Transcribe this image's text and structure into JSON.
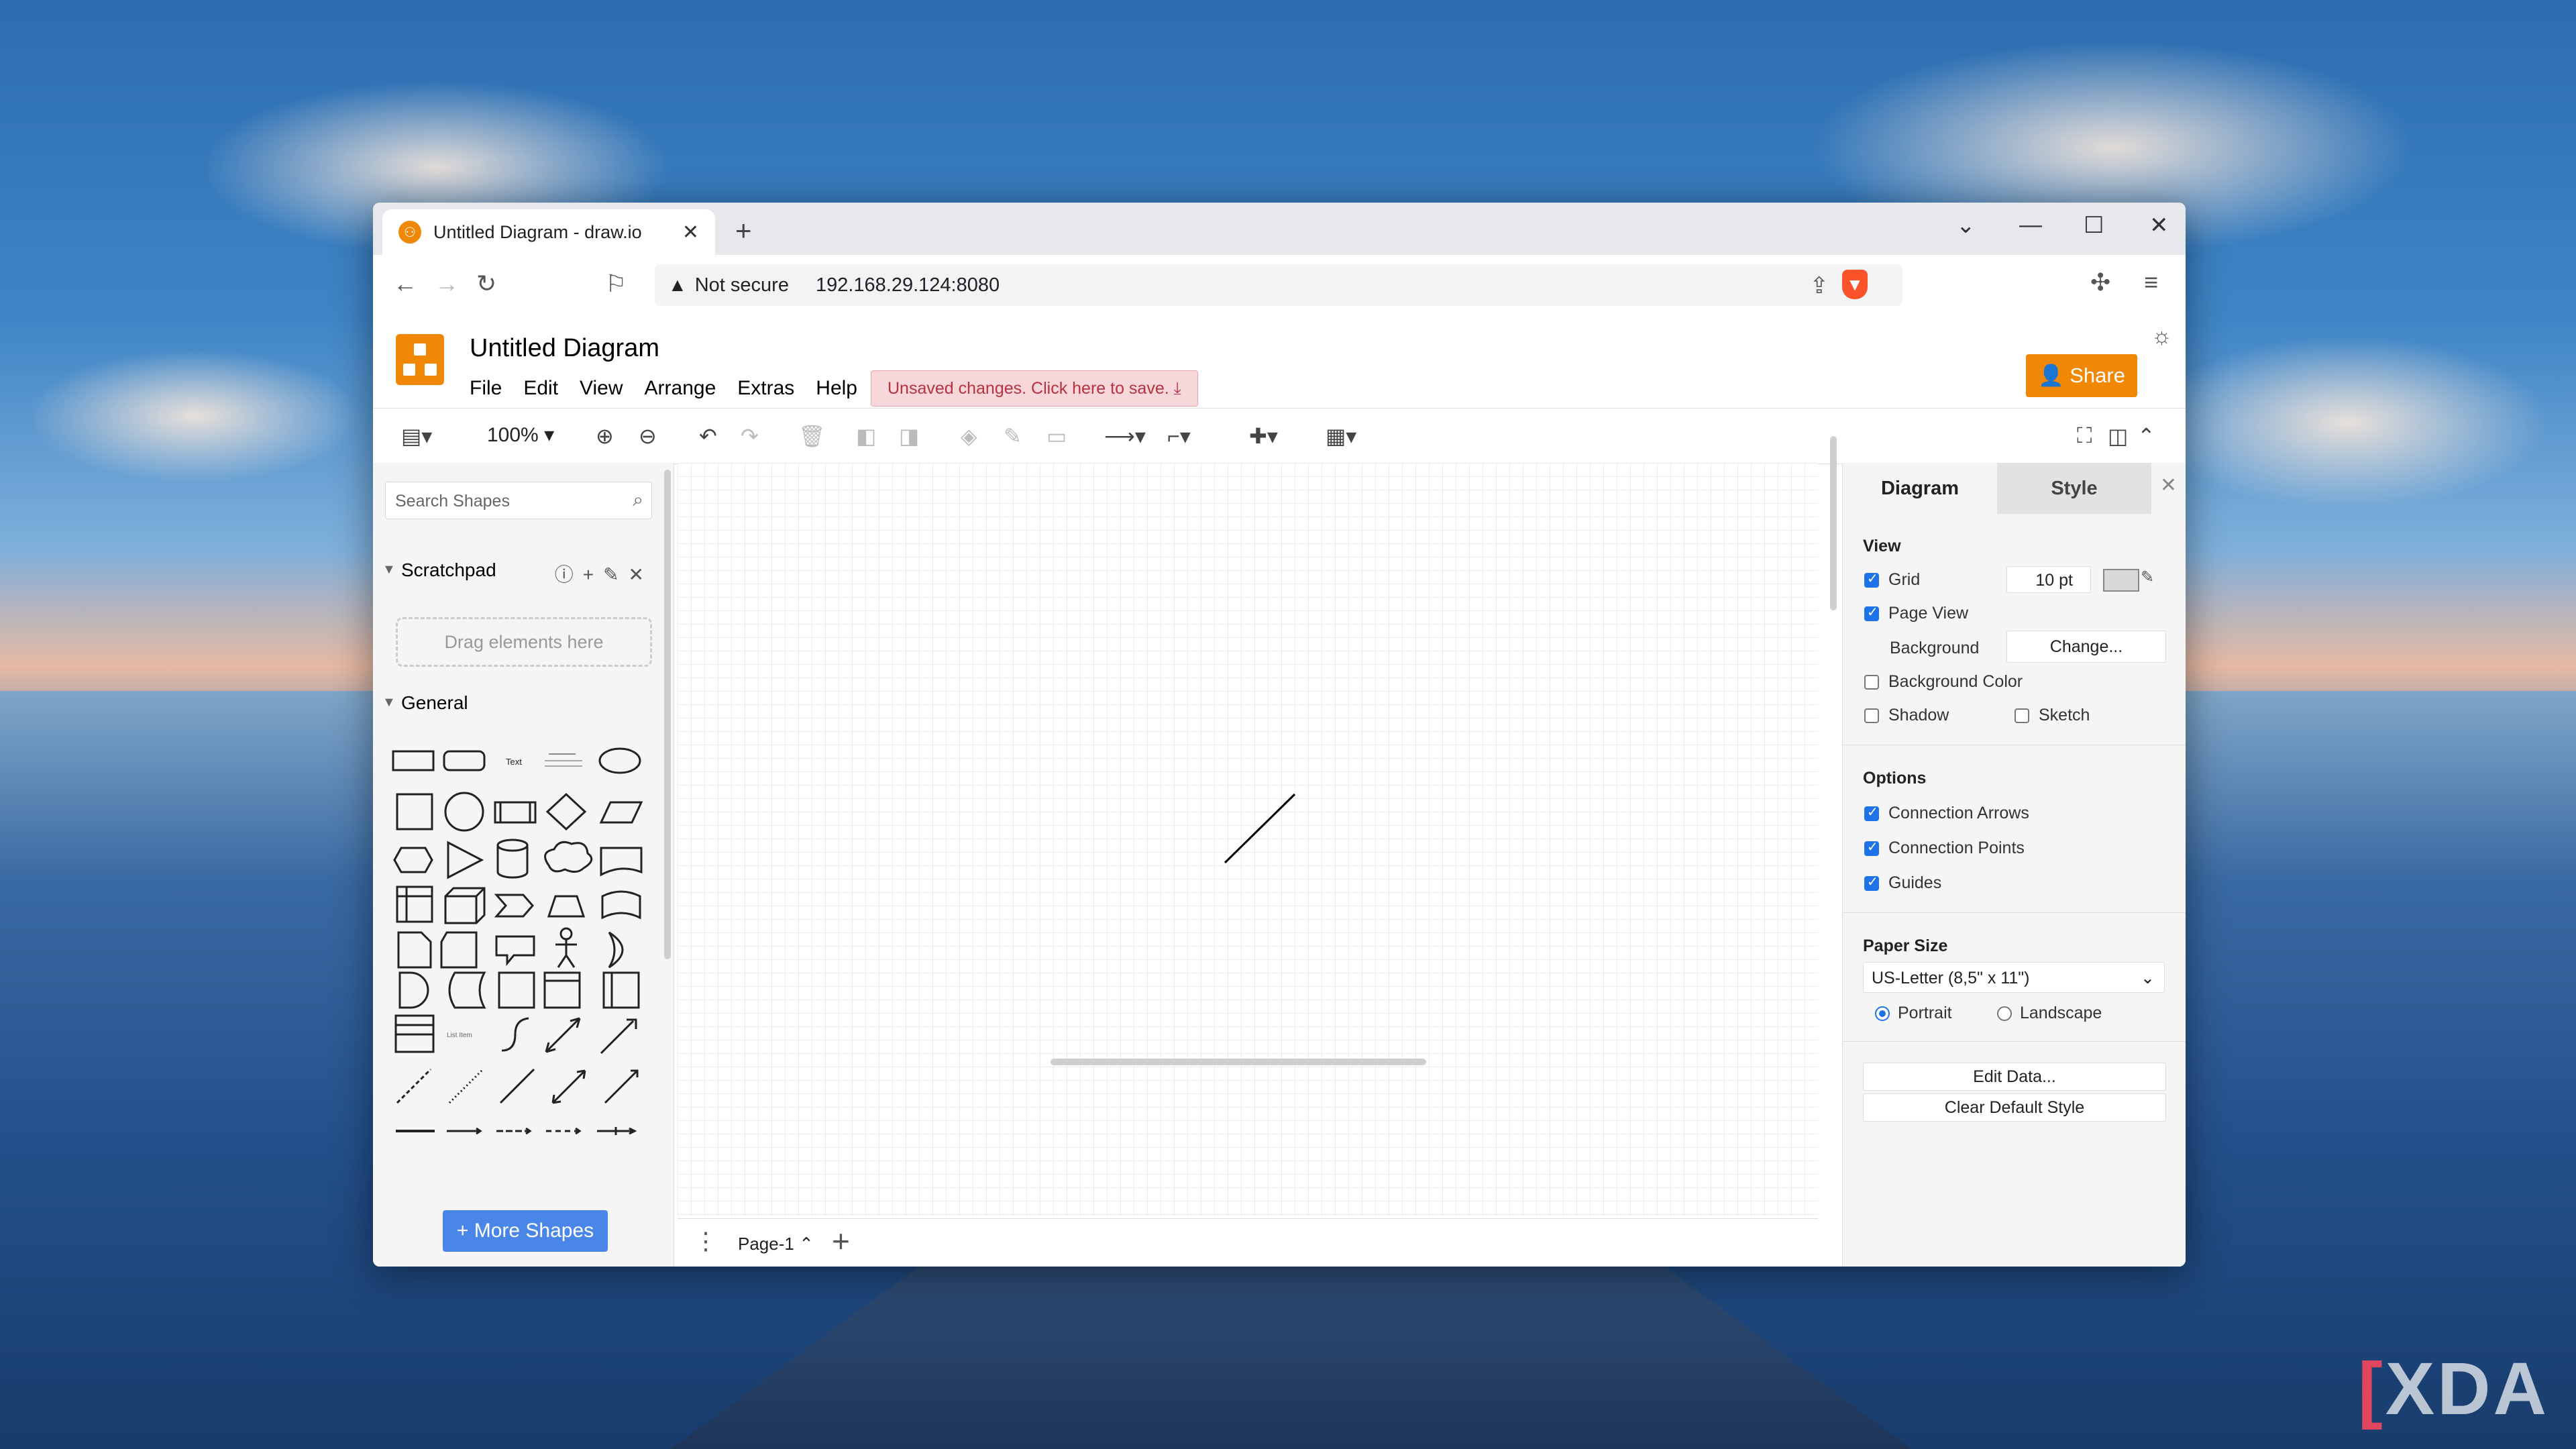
{
  "browser": {
    "tab_title": "Untitled Diagram - draw.io",
    "security_label": "Not secure",
    "url": "192.168.29.124:8080"
  },
  "app": {
    "title": "Untitled Diagram",
    "menu": [
      "File",
      "Edit",
      "View",
      "Arrange",
      "Extras",
      "Help"
    ],
    "unsaved_notice": "Unsaved changes. Click here to save.",
    "share_label": "Share",
    "zoom": "100%"
  },
  "sidebar": {
    "search_placeholder": "Search Shapes",
    "scratchpad_title": "Scratchpad",
    "drag_hint": "Drag elements here",
    "general_title": "General",
    "more_shapes": "+ More Shapes"
  },
  "canvas": {
    "page_tab": "Page-1"
  },
  "format_panel": {
    "tabs": [
      "Diagram",
      "Style"
    ],
    "view_header": "View",
    "grid_label": "Grid",
    "grid_size": "10 pt",
    "page_view_label": "Page View",
    "background_label": "Background",
    "change_button": "Change...",
    "background_color_label": "Background Color",
    "shadow_label": "Shadow",
    "sketch_label": "Sketch",
    "options_header": "Options",
    "connection_arrows": "Connection Arrows",
    "connection_points": "Connection Points",
    "guides": "Guides",
    "paper_size_header": "Paper Size",
    "paper_size": "US-Letter (8,5\" x 11\")",
    "portrait": "Portrait",
    "landscape": "Landscape",
    "edit_data": "Edit Data...",
    "clear_default_style": "Clear Default Style"
  },
  "watermark": "XDA",
  "colors": {
    "accent": "#f08705",
    "link_blue": "#4a86e8",
    "checkbox": "#1e73e8"
  }
}
